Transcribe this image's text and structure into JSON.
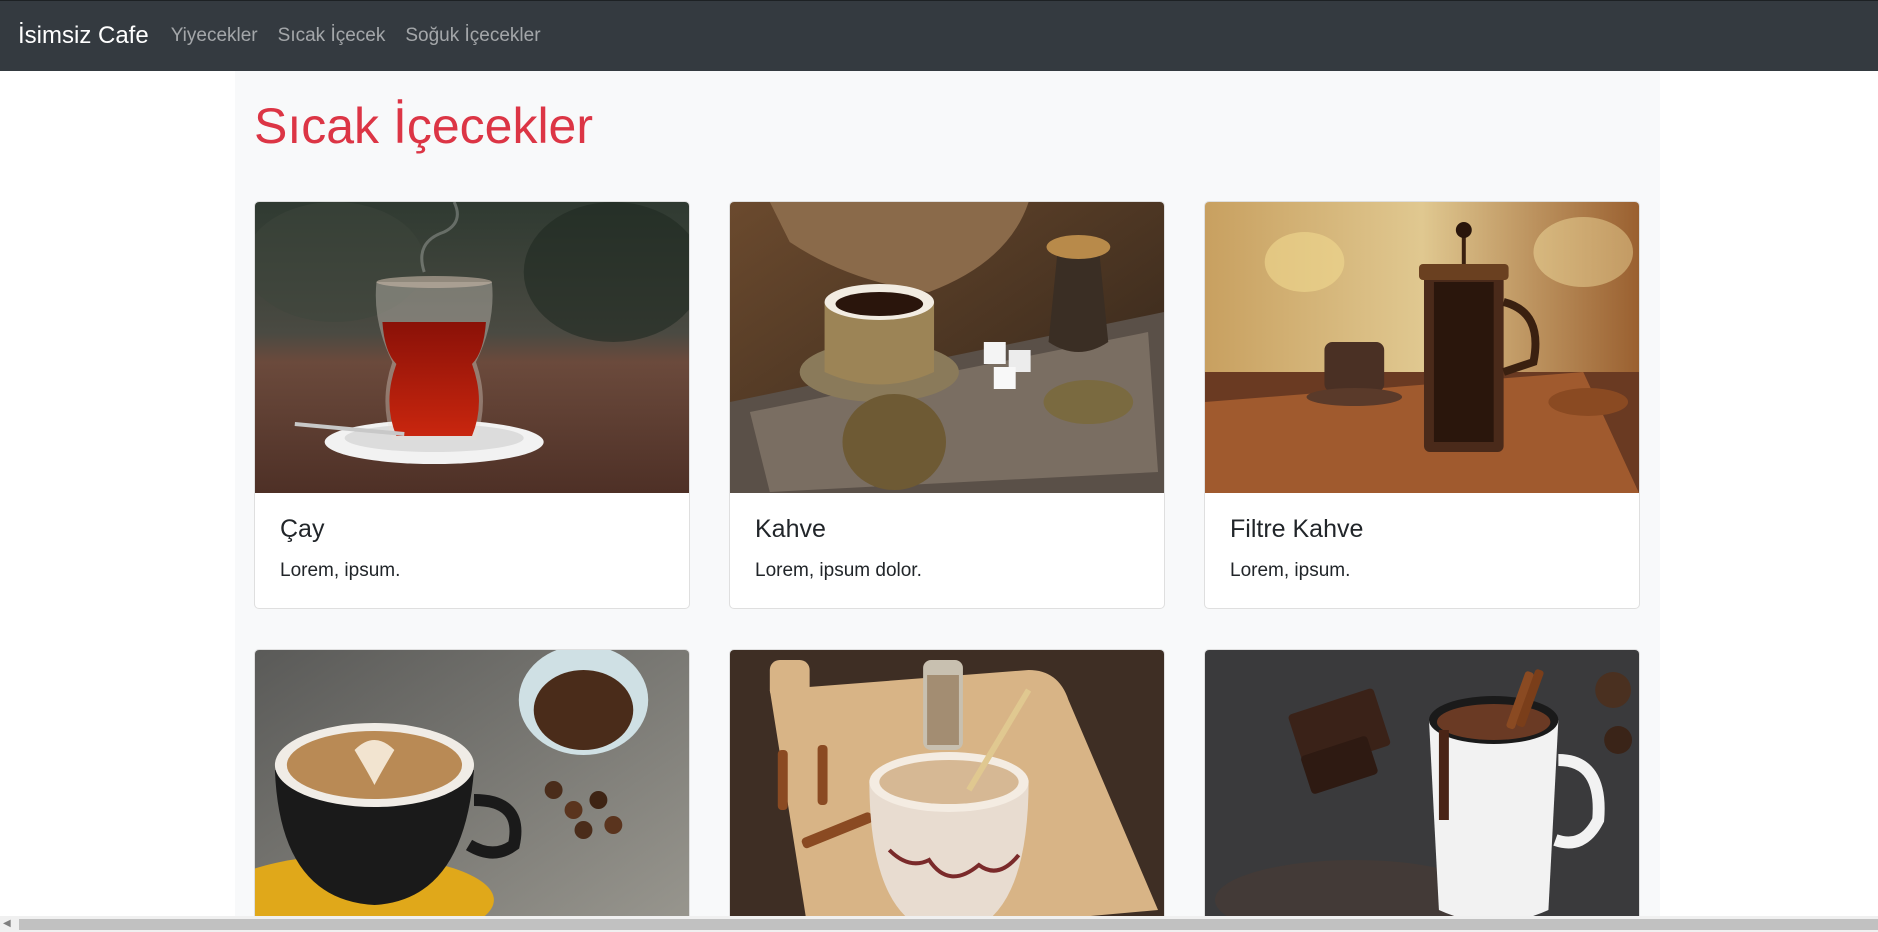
{
  "navbar": {
    "brand": "İsimsiz Cafe",
    "links": [
      "Yiyecekler",
      "Sıcak İçecek",
      "Soğuk İçecekler"
    ]
  },
  "page": {
    "title": "Sıcak İçecekler"
  },
  "cards": [
    {
      "title": "Çay",
      "text": "Lorem, ipsum.",
      "image": "turkish-tea-glass-photo"
    },
    {
      "title": "Kahve",
      "text": "Lorem, ipsum dolor.",
      "image": "turkish-coffee-set-photo"
    },
    {
      "title": "Filtre Kahve",
      "text": "Lorem, ipsum.",
      "image": "french-press-coffee-photo"
    },
    {
      "title": "",
      "text": "",
      "image": "latte-art-coffee-photo"
    },
    {
      "title": "",
      "text": "",
      "image": "salep-cinnamon-photo"
    },
    {
      "title": "",
      "text": "",
      "image": "hot-chocolate-mug-photo"
    }
  ],
  "colors": {
    "navbar_bg": "#343a40",
    "title_red": "#dc3545",
    "container_bg": "#f8f9fa"
  }
}
